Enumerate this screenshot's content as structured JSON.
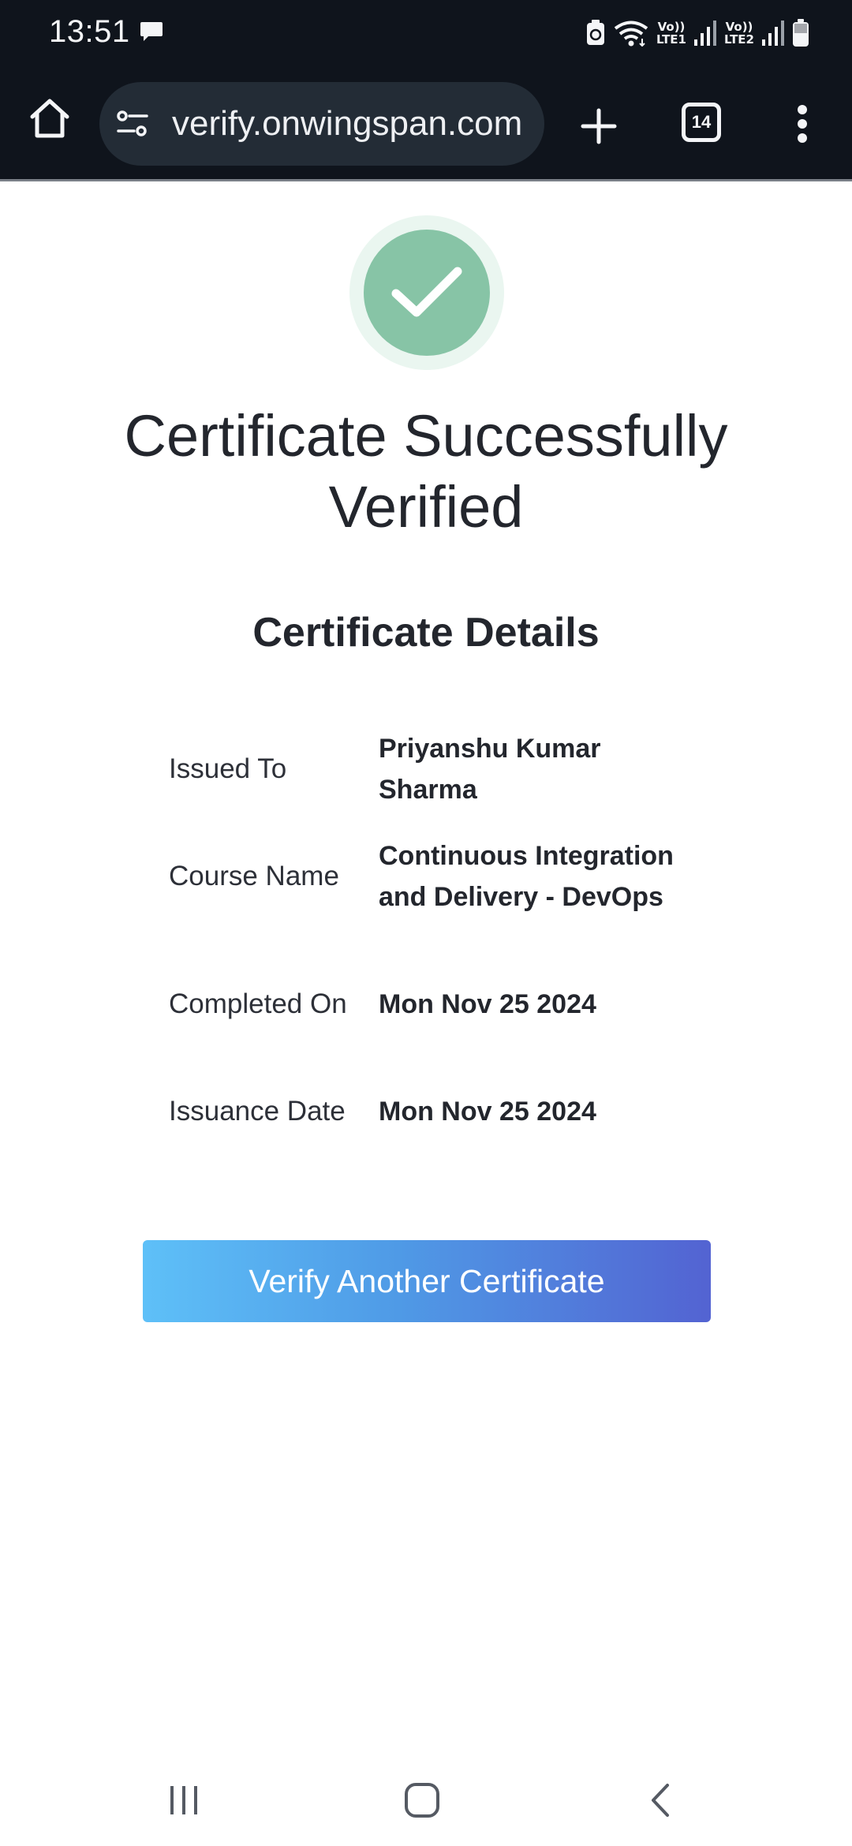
{
  "status_bar": {
    "time": "13:51",
    "icons": [
      "message-icon",
      "battery-saver-icon",
      "wifi-icon",
      "signal-sim1-icon",
      "signal-sim2-icon",
      "battery-icon"
    ],
    "sim1_label_top": "Vo))",
    "sim1_label_bottom": "LTE1",
    "sim2_label_top": "Vo))",
    "sim2_label_bottom": "LTE2"
  },
  "browser": {
    "url": "verify.onwingspan.com",
    "tab_count": "14",
    "icons": [
      "home-icon",
      "site-settings-icon",
      "plus-icon",
      "tabs-icon",
      "more-vert-icon"
    ]
  },
  "page": {
    "status_icon": "check-circle-icon",
    "title": "Certificate Successfully Verified",
    "details_heading": "Certificate Details",
    "details": [
      {
        "label": "Issued To",
        "value": "Priyanshu Kumar Sharma"
      },
      {
        "label": "Course Name",
        "value": "Continuous Integration and Delivery - DevOps"
      },
      {
        "label": "Completed On",
        "value": "Mon Nov 25 2024"
      },
      {
        "label": "Issuance Date",
        "value": "Mon Nov 25 2024"
      }
    ],
    "verify_button_label": "Verify Another Certificate"
  },
  "nav_bar": {
    "icons": [
      "recent-apps-icon",
      "home-circle-icon",
      "back-icon"
    ]
  },
  "colors": {
    "system_bar": "#0f141c",
    "url_bar": "#232c36",
    "check_green": "#87c4a6",
    "button_gradient_start": "#5ec0f8",
    "button_gradient_end": "#5363d2"
  }
}
